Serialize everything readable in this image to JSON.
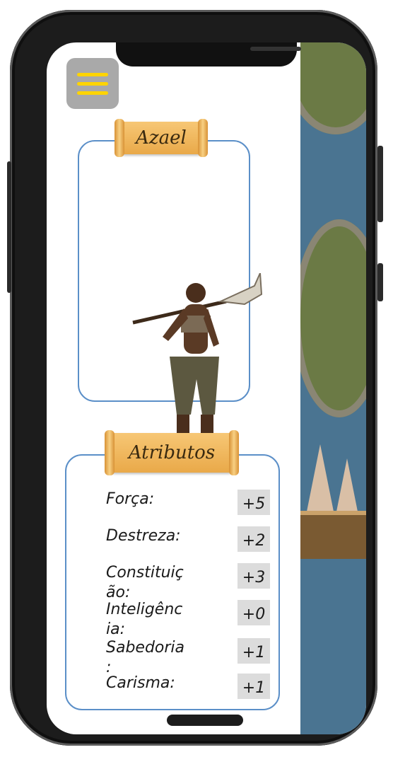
{
  "menu": {
    "icon": "hamburger-menu-icon"
  },
  "character": {
    "name": "Azael"
  },
  "attributes_panel": {
    "title": "Atributos",
    "items": [
      {
        "label": "Força:",
        "value": "+5"
      },
      {
        "label": "Destreza:",
        "value": "+2"
      },
      {
        "label": "Constituição:",
        "value": "+3"
      },
      {
        "label": "Inteligência:",
        "value": "+0"
      },
      {
        "label": "Sabedoria:",
        "value": "+1"
      },
      {
        "label": "Carisma:",
        "value": "+1"
      }
    ]
  },
  "colors": {
    "accent_border": "#5b8fc8",
    "menu_bars": "#ffd400",
    "scroll": "#f0b85c"
  }
}
